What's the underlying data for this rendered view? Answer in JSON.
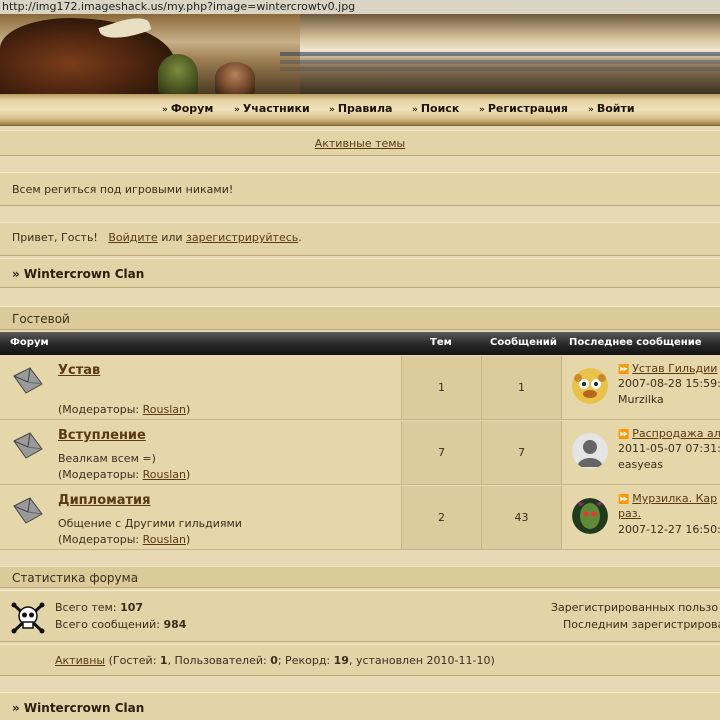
{
  "url": "http://img172.imageshack.us/my.php?image=wintercrowtv0.jpg",
  "nav": [
    {
      "label": "Форум"
    },
    {
      "label": "Участники"
    },
    {
      "label": "Правила"
    },
    {
      "label": "Поиск"
    },
    {
      "label": "Регистрация"
    },
    {
      "label": "Войти"
    }
  ],
  "active_topics": "Активные темы",
  "announcement": "Всем региться под игровыми никами!",
  "greeting": {
    "prefix": "Привет, Гость!",
    "login": "Войдите",
    "or": "или",
    "register": "зарегистрируйтесь",
    "suffix": "."
  },
  "clan_title": "» Wintercrown Clan",
  "category": "Гостевой",
  "table_headers": {
    "forum": "Форум",
    "topics": "Тем",
    "posts": "Сообщений",
    "last": "Последнее сообщение"
  },
  "forums": [
    {
      "title": "Устав",
      "description": "",
      "mods_prefix": "(Модераторы: ",
      "moderator": "Rouslan",
      "mods_suffix": ")",
      "topics": "1",
      "posts": "1",
      "last_title": "Устав Гильдии",
      "last_title2": "",
      "last_date": "2007-08-28 15:59:",
      "last_author": "Murzilka"
    },
    {
      "title": "Вступление",
      "description": "Веалкам всем =)",
      "mods_prefix": "(Модераторы: ",
      "moderator": "Rouslan",
      "mods_suffix": ")",
      "topics": "7",
      "posts": "7",
      "last_title": "Распродажа ал",
      "last_title2": "",
      "last_date": "2011-05-07 07:31:",
      "last_author": "easyeas"
    },
    {
      "title": "Дипломатия",
      "description": "Общение с Другими гильдиями",
      "mods_prefix": "(Модераторы: ",
      "moderator": "Rouslan",
      "mods_suffix": ")",
      "topics": "2",
      "posts": "43",
      "last_title": "Мурзилка. Кар",
      "last_title2": "раз.",
      "last_date": "2007-12-27 16:50:",
      "last_author": ""
    }
  ],
  "stats": {
    "title": "Статистика форума",
    "total_topics_label": "Всего тем:",
    "total_topics": "107",
    "total_posts_label": "Всего сообщений:",
    "total_posts": "984",
    "registered_label": "Зарегистрированных пользо",
    "last_registered_label": "Последним зарегистрирова"
  },
  "online": {
    "link": "Активны",
    "guests_label": " (Гостей: ",
    "guests": "1",
    "users_label": ", Пользователей: ",
    "users": "0",
    "record_label": "; Рекорд: ",
    "record": "19",
    "record_date": ", установлен 2010-11-10)"
  },
  "clan_title_2": "» Wintercrown Clan",
  "icons": {
    "nav_bullet": "double-chevron-right-icon",
    "forum": "envelope-icon",
    "last_post": "go-to-post-icon",
    "stats": "skull-crossbones-icon"
  }
}
